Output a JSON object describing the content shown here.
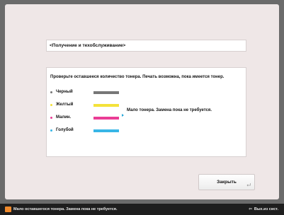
{
  "dialog": {
    "title": "<Получение и техобслуживание>",
    "message": "Проверьте оставшееся количество тонера. Печать возможна, пока имеется тонер.",
    "toners": [
      {
        "label": "Черный",
        "color": "#777777"
      },
      {
        "label": "Желтый",
        "color": "#f4e23a"
      },
      {
        "label": "Малин.",
        "color": "#ea3d95"
      },
      {
        "label": "Голубой",
        "color": "#38b6e6"
      }
    ],
    "low_toner_note": "Мало тонера. Замена пока не требуется.",
    "close_label": "Закрыть"
  },
  "statusbar": {
    "message": "Мало оставшегося тонера. Замена пока не требуется.",
    "right_label": "Вых.из сист."
  },
  "icons": {
    "toner_dot": "bullet",
    "note_arrow": "arrow-right-icon",
    "enter": "enter-return-icon",
    "status_warning": "warning-icon",
    "logout": "logout-icon"
  }
}
